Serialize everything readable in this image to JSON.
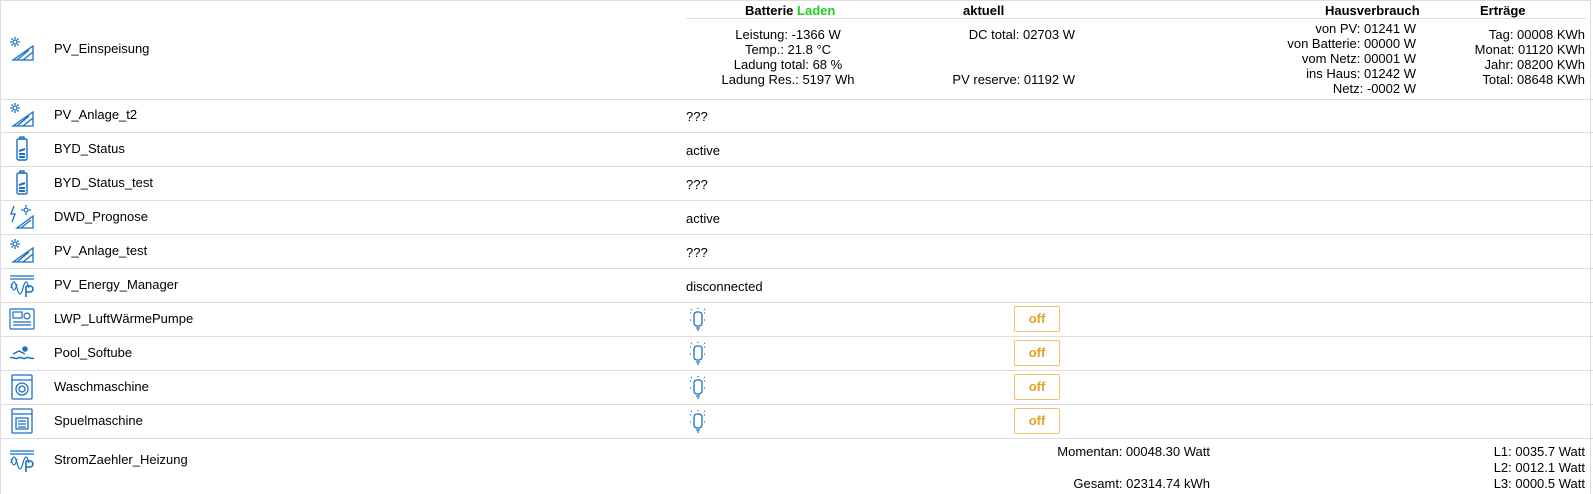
{
  "colors": {
    "icon": "#1a6fc4",
    "accent_green": "#22cc22",
    "off_orange": "#e8a020",
    "off_border": "#f0c36a"
  },
  "header": {
    "batterie_label": "Batterie",
    "batterie_state": "Laden",
    "aktuell": "aktuell",
    "hausverbrauch": "Hausverbrauch",
    "ertraege": "Erträge"
  },
  "pv_einspeisung": {
    "name": "PV_Einspeisung",
    "icon": "solar-panel-icon",
    "batterie": [
      "Leistung: -1366 W",
      "Temp.: 21.8 °C",
      "Ladung total: 68 %",
      "Ladung Res.: 5197 Wh"
    ],
    "dc_total": "DC total: 02703 W",
    "pv_reserve": "PV reserve: 01192 W",
    "hausverbrauch": [
      "von PV: 01241 W",
      "von Batterie: 00000 W",
      "vom Netz: 00001 W",
      "ins Haus: 01242 W",
      "Netz: -0002 W"
    ],
    "ertraege": [
      "Tag: 00008 KWh",
      "Monat: 01120 KWh",
      "Jahr: 08200 KWh",
      "Total: 08648 KWh"
    ]
  },
  "rows": [
    {
      "name": "PV_Anlage_t2",
      "status": "???",
      "icon": "solar-panel-icon"
    },
    {
      "name": "BYD_Status",
      "status": "active",
      "icon": "battery-icon"
    },
    {
      "name": "BYD_Status_test",
      "status": "???",
      "icon": "battery-icon"
    },
    {
      "name": "DWD_Prognose",
      "status": "active",
      "icon": "weather-forecast-icon"
    },
    {
      "name": "PV_Anlage_test",
      "status": "???",
      "icon": "solar-panel-icon"
    },
    {
      "name": "PV_Energy_Manager",
      "status": "disconnected",
      "icon": "energy-meter-icon"
    }
  ],
  "devices": [
    {
      "name": "LWP_LuftWärmePumpe",
      "state": "off",
      "icon": "heat-pump-icon"
    },
    {
      "name": "Pool_Softube",
      "state": "off",
      "icon": "pool-icon"
    },
    {
      "name": "Waschmaschine",
      "state": "off",
      "icon": "washing-machine-icon"
    },
    {
      "name": "Spuelmaschine",
      "state": "off",
      "icon": "dishwasher-icon"
    }
  ],
  "stromzaehler": {
    "name": "StromZaehler_Heizung",
    "icon": "energy-meter-icon",
    "momentan": "Momentan: 00048.30 Watt",
    "gesamt": "Gesamt: 02314.74 kWh",
    "phases": [
      "L1: 0035.7 Watt",
      "L2: 0012.1 Watt",
      "L3: 0000.5 Watt"
    ]
  }
}
